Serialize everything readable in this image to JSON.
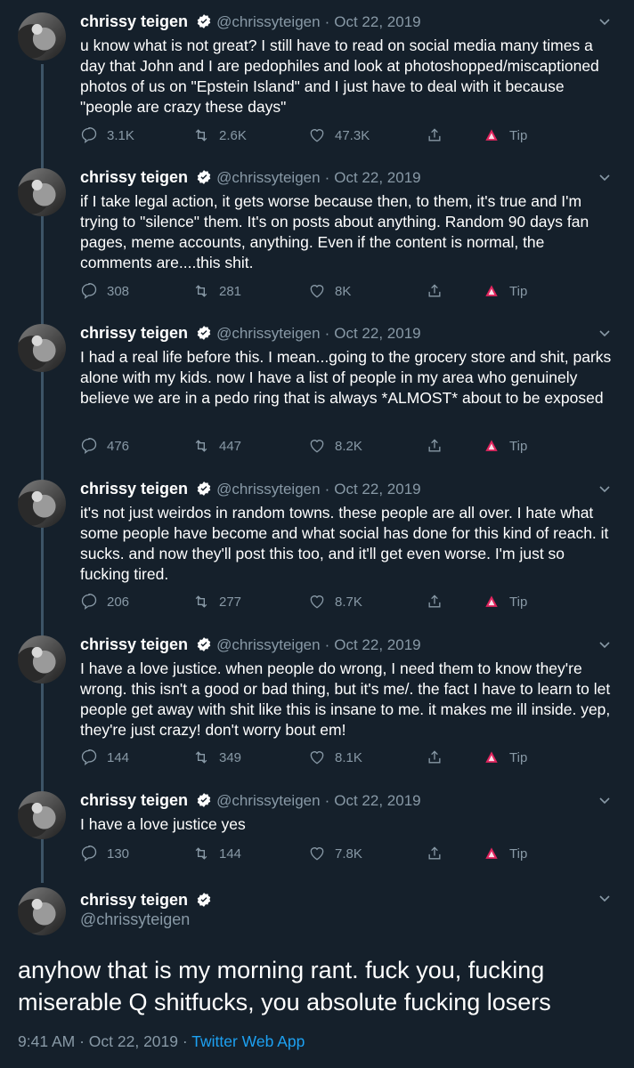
{
  "tweets": [
    {
      "name": "chrissy teigen",
      "handle": "@chrissyteigen",
      "dot": "·",
      "date": "Oct 22, 2019",
      "text": "u know what is not great? I still have to read on social media many times a day that John and I are pedophiles and look at photoshopped/miscaptioned photos of us on \"Epstein Island\" and I just have to deal with it because \"people are crazy these days\"",
      "replies": "3.1K",
      "retweets": "2.6K",
      "likes": "47.3K",
      "tip": "Tip"
    },
    {
      "name": "chrissy teigen",
      "handle": "@chrissyteigen",
      "dot": "·",
      "date": "Oct 22, 2019",
      "text": "if I take legal action, it gets worse because then, to them, it's true and I'm trying to \"silence\" them. It's on posts about anything. Random 90 days fan pages, meme accounts, anything. Even if the content is normal, the comments are....this shit.",
      "replies": "308",
      "retweets": "281",
      "likes": "8K",
      "tip": "Tip"
    },
    {
      "name": "chrissy teigen",
      "handle": "@chrissyteigen",
      "dot": "·",
      "date": "Oct 22, 2019",
      "text": "I had a real life before this. I mean...going to the grocery store and shit, parks alone with my kids. now I have a list of people in my area who genuinely believe we are in a pedo ring that is always *ALMOST* about to be exposed",
      "replies": "476",
      "retweets": "447",
      "likes": "8.2K",
      "tip": "Tip"
    },
    {
      "name": "chrissy teigen",
      "handle": "@chrissyteigen",
      "dot": "·",
      "date": "Oct 22, 2019",
      "text": "it's not just weirdos in random towns. these people are all over. I hate what some people have become and what social has done for this kind of reach. it sucks. and now they'll post this too, and it'll get even worse. I'm just so fucking tired.",
      "replies": "206",
      "retweets": "277",
      "likes": "8.7K",
      "tip": "Tip"
    },
    {
      "name": "chrissy teigen",
      "handle": "@chrissyteigen",
      "dot": "·",
      "date": "Oct 22, 2019",
      "text": "I have a love justice. when people do wrong, I need them to know they're wrong. this isn't a good or bad thing, but it's me/. the fact I have to learn to let people get away with shit like this is insane to me. it makes me ill inside. yep, they're just crazy! don't worry bout em!",
      "replies": "144",
      "retweets": "349",
      "likes": "8.1K",
      "tip": "Tip"
    },
    {
      "name": "chrissy teigen",
      "handle": "@chrissyteigen",
      "dot": "·",
      "date": "Oct 22, 2019",
      "text": "I have a love justice yes",
      "replies": "130",
      "retweets": "144",
      "likes": "7.8K",
      "tip": "Tip"
    }
  ],
  "main_tweet": {
    "name": "chrissy teigen",
    "handle": "@chrissyteigen",
    "text": "anyhow that is my morning rant. fuck you, fucking miserable Q shitfucks, you absolute fucking losers",
    "time": "9:41 AM",
    "sep": "·",
    "date": "Oct 22, 2019",
    "sep2": "·",
    "app": "Twitter Web App"
  },
  "colors": {
    "background": "#15202b",
    "secondary_text": "#8899a6",
    "thread_line": "#3d5466",
    "verified": "#ffffff",
    "tip_accent": "#e0245e",
    "link": "#1da1f2"
  },
  "icons": [
    "verified-icon",
    "chevron-down-icon",
    "reply-icon",
    "retweet-icon",
    "like-icon",
    "share-icon",
    "tip-icon"
  ]
}
